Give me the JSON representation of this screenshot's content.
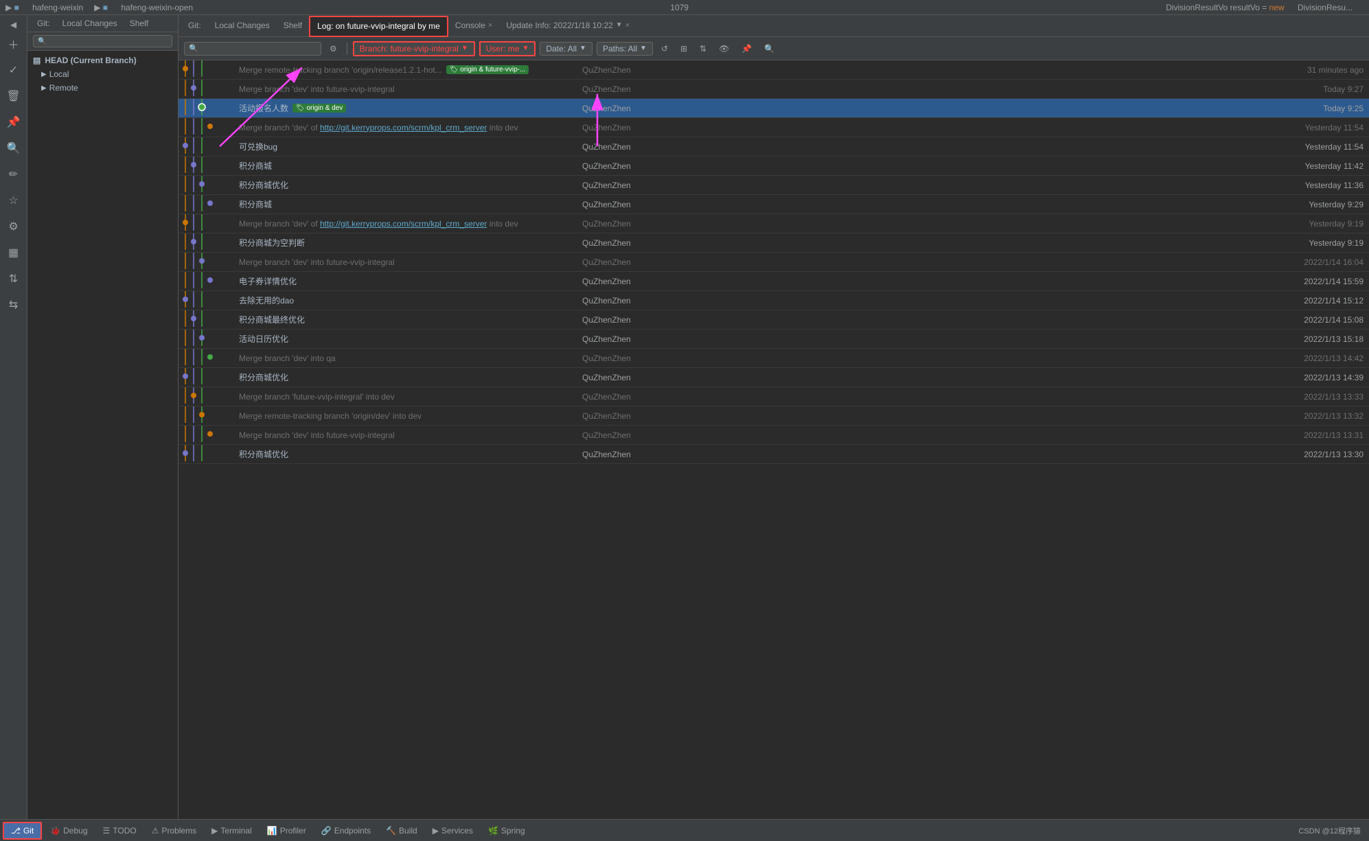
{
  "topBar": {
    "items": [
      "hafeng-weixin",
      "hafeng-weixin-open"
    ],
    "lineNumber": "1079",
    "codeSnippet": "DivisionResultVo resultVo = new DivisionResu..."
  },
  "gitTabs": {
    "items": [
      {
        "label": "Git:",
        "isLabel": true
      },
      {
        "label": "Local Changes"
      },
      {
        "label": "Shelf"
      },
      {
        "label": "Log: on future-vvip-integral by me",
        "active": true,
        "highlighted": true
      },
      {
        "label": "Console",
        "closeable": true
      },
      {
        "label": "Update Info: 2022/1/18 10:22",
        "dropdown": true,
        "closeable": true
      }
    ]
  },
  "logToolbar": {
    "searchPlaceholder": "🔍",
    "branchFilter": "Branch: future-vvip-integral",
    "userFilter": "User: me",
    "dateFilter": "Date: All",
    "pathsFilter": "Paths: All"
  },
  "branches": {
    "head": "HEAD (Current Branch)",
    "local": "Local",
    "remote": "Remote"
  },
  "commits": [
    {
      "message": "Merge remote-tracking branch 'origin/release1.2.1-hot...",
      "tags": [
        "origin & future-vvip-..."
      ],
      "tagColor": "green",
      "author": "QuZhenZhen",
      "date": "31 minutes ago",
      "isMerge": true,
      "graphColor": "#cc7700"
    },
    {
      "message": "Merge branch 'dev' into future-vvip-integral",
      "tags": [],
      "author": "QuZhenZhen",
      "date": "Today 9:27",
      "isMerge": true,
      "graphColor": "#7777cc"
    },
    {
      "message": "活动报名人数",
      "tags": [
        "origin & dev"
      ],
      "tagColor": "green",
      "author": "QuZhenZhen",
      "date": "Today 9:25",
      "selected": true,
      "graphColor": "#44aa44"
    },
    {
      "message": "Merge branch 'dev' of http://git.kerryprops.com/scrm/kpl_crm_server into dev",
      "link": "http://git.kerryprops.com/scrm/kpl_crm_server",
      "tags": [],
      "author": "QuZhenZhen",
      "date": "Yesterday 11:54",
      "isMerge": true,
      "graphColor": "#cc7700"
    },
    {
      "message": "可兑换bug",
      "tags": [],
      "author": "QuZhenZhen",
      "date": "Yesterday 11:54",
      "graphColor": "#7777cc"
    },
    {
      "message": "积分商城",
      "tags": [],
      "author": "QuZhenZhen",
      "date": "Yesterday 11:42",
      "graphColor": "#7777cc"
    },
    {
      "message": "积分商城优化",
      "tags": [],
      "author": "QuZhenZhen",
      "date": "Yesterday 11:36",
      "graphColor": "#7777cc"
    },
    {
      "message": "积分商城",
      "tags": [],
      "author": "QuZhenZhen",
      "date": "Yesterday 9:29",
      "graphColor": "#7777cc"
    },
    {
      "message": "Merge branch 'dev' of http://git.kerryprops.com/scrm/kpl_crm_server into dev",
      "link": "http://git.kerryprops.com/scrm/kpl_crm_server",
      "tags": [],
      "author": "QuZhenZhen",
      "date": "Yesterday 9:19",
      "isMerge": true,
      "graphColor": "#cc7700"
    },
    {
      "message": "积分商城为空判断",
      "tags": [],
      "author": "QuZhenZhen",
      "date": "Yesterday 9:19",
      "graphColor": "#7777cc"
    },
    {
      "message": "Merge branch 'dev' into future-vvip-integral",
      "tags": [],
      "author": "QuZhenZhen",
      "date": "2022/1/14 16:04",
      "isMerge": true,
      "graphColor": "#7777cc"
    },
    {
      "message": "电子券详情优化",
      "tags": [],
      "author": "QuZhenZhen",
      "date": "2022/1/14 15:59",
      "graphColor": "#7777cc"
    },
    {
      "message": "去除无用的dao",
      "tags": [],
      "author": "QuZhenZhen",
      "date": "2022/1/14 15:12",
      "graphColor": "#7777cc"
    },
    {
      "message": "积分商城最终优化",
      "tags": [],
      "author": "QuZhenZhen",
      "date": "2022/1/14 15:08",
      "graphColor": "#7777cc"
    },
    {
      "message": "活动日历优化",
      "tags": [],
      "author": "QuZhenZhen",
      "date": "2022/1/13 15:18",
      "graphColor": "#7777cc"
    },
    {
      "message": "Merge branch 'dev' into qa",
      "tags": [],
      "author": "QuZhenZhen",
      "date": "2022/1/13 14:42",
      "isMerge": true,
      "graphColor": "#44aa44"
    },
    {
      "message": "积分商城优化",
      "tags": [],
      "author": "QuZhenZhen",
      "date": "2022/1/13 14:39",
      "graphColor": "#7777cc"
    },
    {
      "message": "Merge branch 'future-vvip-integral' into dev",
      "tags": [],
      "author": "QuZhenZhen",
      "date": "2022/1/13 13:33",
      "isMerge": true,
      "graphColor": "#cc7700"
    },
    {
      "message": "Merge remote-tracking branch 'origin/dev' into dev",
      "tags": [],
      "author": "QuZhenZhen",
      "date": "2022/1/13 13:32",
      "isMerge": true,
      "graphColor": "#cc7700"
    },
    {
      "message": "Merge branch 'dev' into future-vvip-integral",
      "tags": [],
      "author": "QuZhenZhen",
      "date": "2022/1/13 13:31",
      "isMerge": true,
      "graphColor": "#cc7700"
    },
    {
      "message": "积分商城优化",
      "tags": [],
      "author": "QuZhenZhen",
      "date": "2022/1/13 13:30",
      "graphColor": "#7777cc"
    }
  ],
  "bottomBar": {
    "items": [
      {
        "label": "Git",
        "icon": "git-icon",
        "active": true
      },
      {
        "label": "Debug",
        "icon": "debug-icon"
      },
      {
        "label": "TODO",
        "icon": "todo-icon"
      },
      {
        "label": "Problems",
        "icon": "problems-icon"
      },
      {
        "label": "Terminal",
        "icon": "terminal-icon"
      },
      {
        "label": "Profiler",
        "icon": "profiler-icon"
      },
      {
        "label": "Endpoints",
        "icon": "endpoints-icon"
      },
      {
        "label": "Build",
        "icon": "build-icon"
      },
      {
        "label": "Services",
        "icon": "services-icon"
      },
      {
        "label": "Spring",
        "icon": "spring-icon"
      }
    ],
    "rightText": "CSDN @12程序猿"
  }
}
